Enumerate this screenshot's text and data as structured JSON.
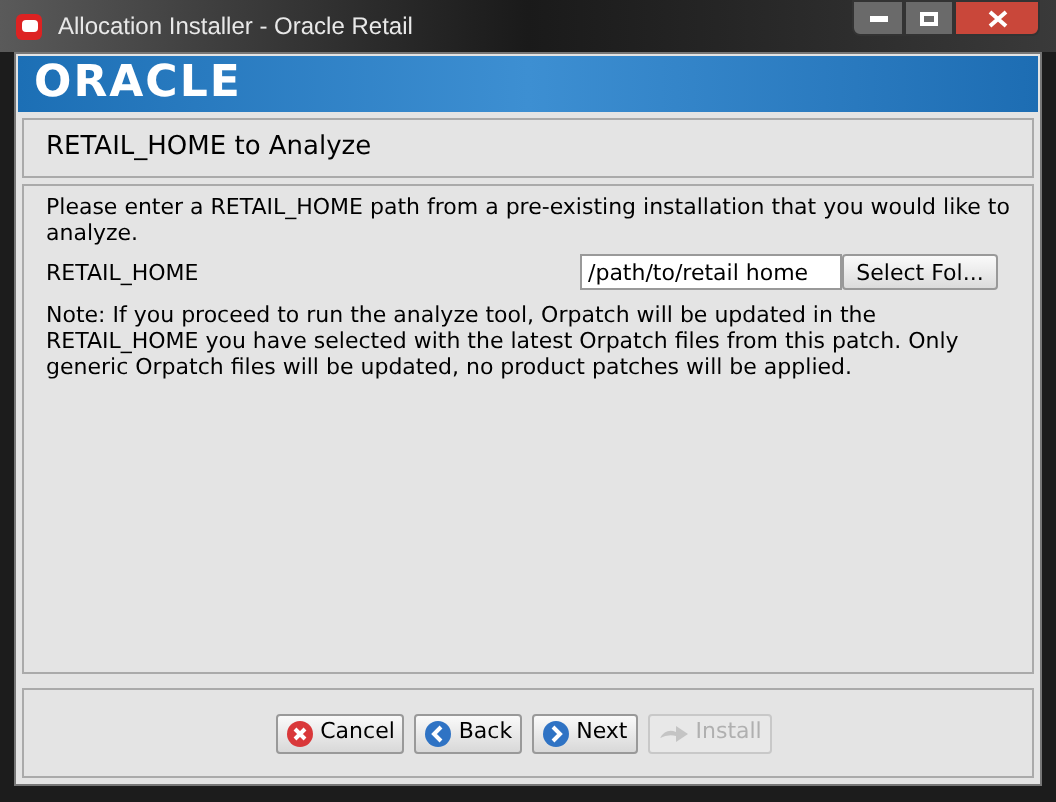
{
  "window": {
    "title": "Allocation Installer - Oracle Retail"
  },
  "banner": {
    "logo": "ORACLE"
  },
  "header": {
    "title": "RETAIL_HOME to Analyze"
  },
  "content": {
    "intro": "Please enter a RETAIL_HOME path from a pre-existing installation that you would like to analyze.",
    "field": {
      "label": "RETAIL_HOME",
      "value": "/path/to/retail home",
      "button": "Select Fol..."
    },
    "note": "Note: If you proceed to run the analyze tool, Orpatch will be updated in the RETAIL_HOME you have selected with the latest Orpatch files from this patch.  Only generic Orpatch files will be updated, no product patches will be applied."
  },
  "buttons": [
    {
      "label": "Cancel",
      "kind": "cancel",
      "disabled": false
    },
    {
      "label": "Back",
      "kind": "back",
      "disabled": false
    },
    {
      "label": "Next",
      "kind": "next",
      "disabled": false
    },
    {
      "label": "Install",
      "kind": "install",
      "disabled": true
    }
  ]
}
